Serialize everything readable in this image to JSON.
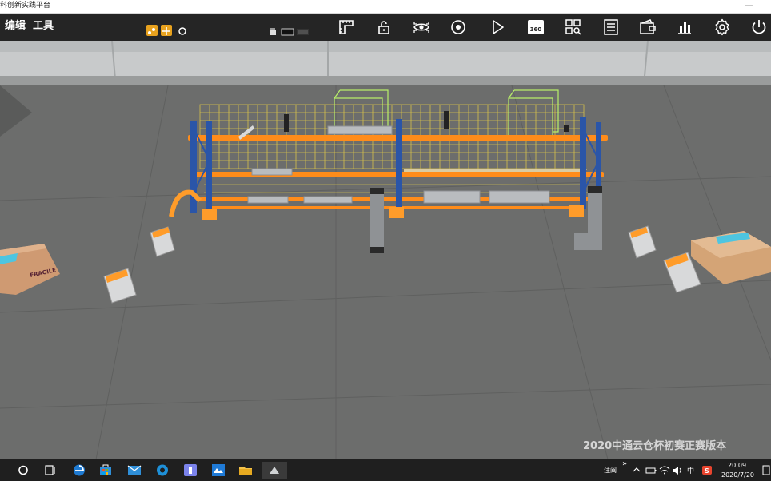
{
  "window": {
    "title": "科创新实践平台",
    "minimize_symbol": "—"
  },
  "menu": {
    "edit": "编辑",
    "tools": "工具"
  },
  "toolbar": {
    "icons": [
      "ruler-icon",
      "lock-icon",
      "eye-icon",
      "record-icon",
      "play-icon",
      "view360-icon",
      "grid-search-icon",
      "list-icon",
      "wallet-icon",
      "chart-icon",
      "gear-icon",
      "power-icon"
    ],
    "label_360": "360°"
  },
  "scene": {
    "watermark": "2020中通云仓杯初赛正赛版本",
    "box_label": "FRAGILE"
  },
  "taskbar": {
    "ime": "注阅",
    "chevron": "»",
    "time": "20:09",
    "date": "2020/7/20",
    "colors": {
      "edge": "#1e7ad2",
      "store": "#2f8fd8",
      "teams": "#7b83eb",
      "explorer": "#f2c24b"
    }
  },
  "colors": {
    "rack_orange": "#ff8c1a",
    "rack_blue": "#2a55a8",
    "grid_yellow": "#f2d64b",
    "selection_green": "#b8f06a",
    "floor": "#6e6f6e",
    "wall": "#c9cbcc"
  }
}
